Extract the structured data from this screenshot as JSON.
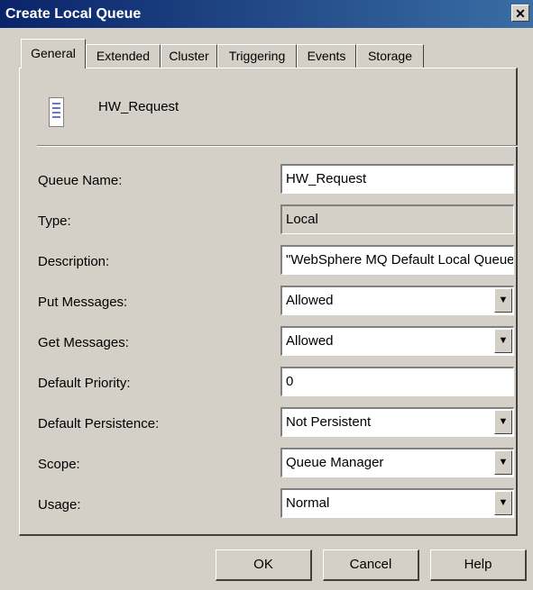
{
  "window": {
    "title": "Create Local Queue",
    "close_glyph": "✕"
  },
  "tabs": [
    "General",
    "Extended",
    "Cluster",
    "Triggering",
    "Events",
    "Storage"
  ],
  "header": {
    "queue_name": "HW_Request"
  },
  "fields": {
    "queue_name": {
      "label": "Queue Name:",
      "value": "HW_Request"
    },
    "type": {
      "label": "Type:",
      "value": "Local"
    },
    "description": {
      "label": "Description:",
      "value": "\"WebSphere MQ Default Local Queue\""
    },
    "put_messages": {
      "label": "Put Messages:",
      "value": "Allowed"
    },
    "get_messages": {
      "label": "Get Messages:",
      "value": "Allowed"
    },
    "default_priority": {
      "label": "Default Priority:",
      "value": "0"
    },
    "default_persistence": {
      "label": "Default Persistence:",
      "value": "Not Persistent"
    },
    "scope": {
      "label": "Scope:",
      "value": "Queue Manager"
    },
    "usage": {
      "label": "Usage:",
      "value": "Normal"
    }
  },
  "dropdown_glyph": "▼",
  "buttons": {
    "ok": "OK",
    "cancel": "Cancel",
    "help": "Help"
  },
  "icons": {
    "header": "queue-icon",
    "close": "close-icon",
    "dropdown": "chevron-down-icon"
  }
}
